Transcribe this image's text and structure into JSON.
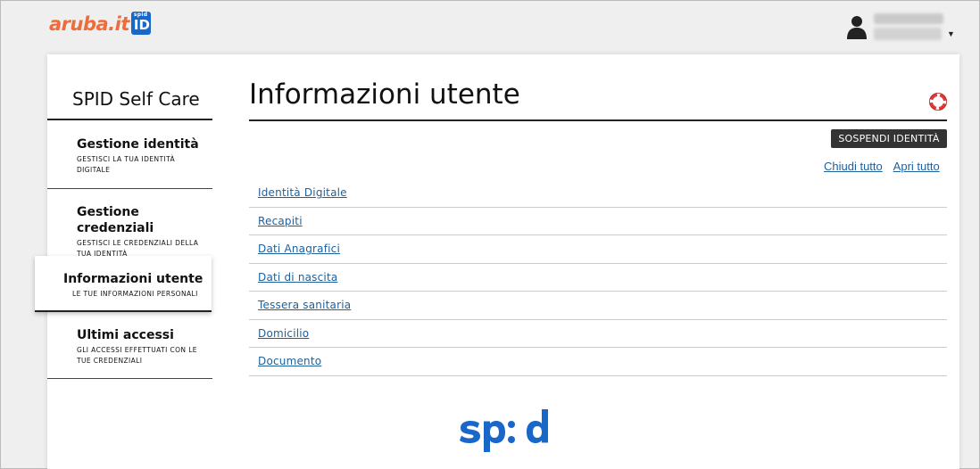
{
  "header": {
    "logo_text": "aruba.it",
    "logo_badge_small": "spid",
    "logo_badge_big": "ID"
  },
  "sidebar": {
    "title": "SPID Self Care",
    "items": [
      {
        "label": "Gestione identità",
        "sub1": "GESTISCI LA TUA IDENTITÀ",
        "sub2": "DIGITALE"
      },
      {
        "label": "Gestione credenziali",
        "sub1": "GESTISCI LE CREDENZIALI DELLA",
        "sub2": "TUA IDENTITÀ"
      },
      {
        "label": "Informazioni utente",
        "sub1": "LE TUE INFORMAZIONI PERSONALI",
        "sub2": ""
      },
      {
        "label": "Ultimi accessi",
        "sub1": "GLI ACCESSI EFFETTUATI CON LE",
        "sub2": "TUE CREDENZIALI"
      }
    ]
  },
  "main": {
    "title": "Informazioni utente",
    "suspend_label": "SOSPENDI IDENTITÀ",
    "collapse_all": "Chiudi tutto",
    "expand_all": "Apri tutto",
    "sections": [
      "Identità Digitale",
      "Recapiti",
      "Dati Anagrafici",
      "Dati di nascita",
      "Tessera sanitaria",
      "Domicilio",
      "Documento"
    ]
  },
  "footer": {
    "logo": "spid"
  },
  "colors": {
    "brand_orange": "#ef6c3a",
    "spid_blue": "#1967c9",
    "link": "#1f5f9a",
    "button_dark": "#333333"
  }
}
